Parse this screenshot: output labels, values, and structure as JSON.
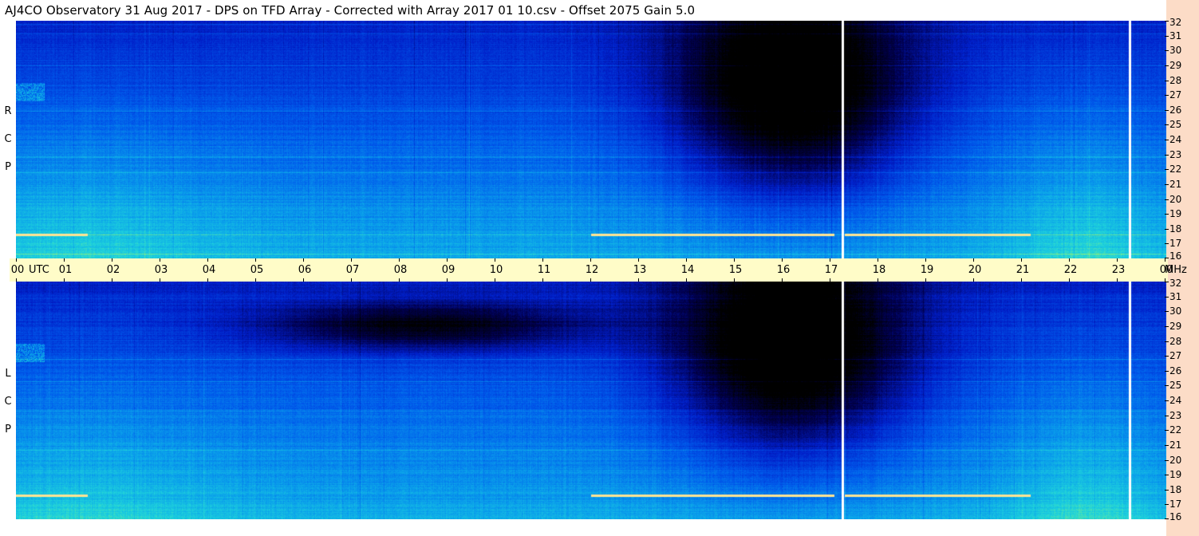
{
  "title": "AJ4CO Observatory  31 Aug 2017  -  DPS on TFD Array  -  Corrected with Array 2017 01 10.csv  -  Offset 2075  Gain 5.0",
  "panels": {
    "top_label": [
      "R",
      "C",
      "P"
    ],
    "bottom_label": [
      "L",
      "C",
      "P"
    ]
  },
  "time_axis": {
    "labels": [
      "00",
      "01",
      "02",
      "03",
      "04",
      "05",
      "06",
      "07",
      "08",
      "09",
      "10",
      "11",
      "12",
      "13",
      "14",
      "15",
      "16",
      "17",
      "18",
      "19",
      "20",
      "21",
      "22",
      "23",
      "00"
    ],
    "utc_label": "UTC",
    "mhz_label": "MHz"
  },
  "freq_axis": {
    "labels": [
      "32",
      "31",
      "30",
      "29",
      "28",
      "27",
      "26",
      "25",
      "24",
      "23",
      "22",
      "21",
      "20",
      "19",
      "18",
      "17",
      "16"
    ]
  },
  "colors": {
    "background": "#ffffff",
    "time_axis_bg": "#fffcc8",
    "right_strip_bg": "#fcdcc7"
  },
  "chart_data": {
    "type": "heatmap",
    "title": "AJ4CO Observatory  31 Aug 2017  -  DPS on TFD Array  -  Corrected with Array 2017 01 10.csv  -  Offset 2075  Gain 5.0",
    "xlabel": "UTC",
    "ylabel": "MHz",
    "x_ticks": [
      "00",
      "01",
      "02",
      "03",
      "04",
      "05",
      "06",
      "07",
      "08",
      "09",
      "10",
      "11",
      "12",
      "13",
      "14",
      "15",
      "16",
      "17",
      "18",
      "19",
      "20",
      "21",
      "22",
      "23",
      "00"
    ],
    "y_ticks": [
      32,
      31,
      30,
      29,
      28,
      27,
      26,
      25,
      24,
      23,
      22,
      21,
      20,
      19,
      18,
      17,
      16
    ],
    "ylim": [
      16,
      32
    ],
    "xlim": [
      0,
      24
    ],
    "series": [
      {
        "name": "RCP"
      },
      {
        "name": "LCP"
      }
    ],
    "colormap": "jet",
    "gaps_utc": [
      17.25,
      23.25
    ]
  }
}
